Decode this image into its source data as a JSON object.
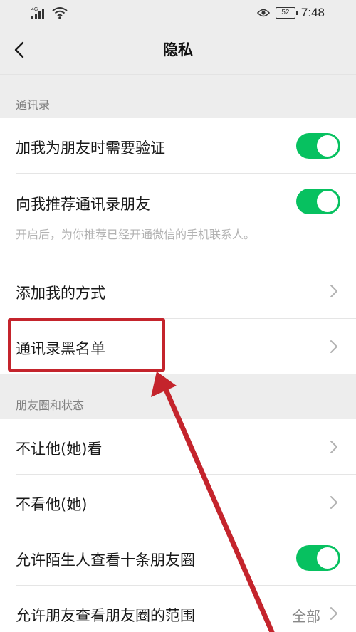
{
  "status_bar": {
    "network": "4G",
    "battery": "52",
    "time": "7:48"
  },
  "header": {
    "title": "隐私"
  },
  "sections": {
    "contacts": {
      "label": "通讯录",
      "verify_friends": {
        "label": "加我为朋友时需要验证",
        "enabled": true
      },
      "recommend_contacts": {
        "label": "向我推荐通讯录朋友",
        "description": "开启后，为你推荐已经开通微信的手机联系人。",
        "enabled": true
      },
      "add_methods": {
        "label": "添加我的方式"
      },
      "blacklist": {
        "label": "通讯录黑名单"
      }
    },
    "moments": {
      "label": "朋友圈和状态",
      "hide_my_posts": {
        "label": "不让他(她)看"
      },
      "hide_their_posts": {
        "label": "不看他(她)"
      },
      "stranger_ten_posts": {
        "label": "允许陌生人查看十条朋友圈",
        "enabled": true
      },
      "visible_range": {
        "label": "允许朋友查看朋友圈的范围",
        "value": "全部"
      }
    }
  },
  "annotation": {
    "color": "#c4242c"
  },
  "colors": {
    "toggle_on": "#07c160",
    "background": "#ededed"
  }
}
